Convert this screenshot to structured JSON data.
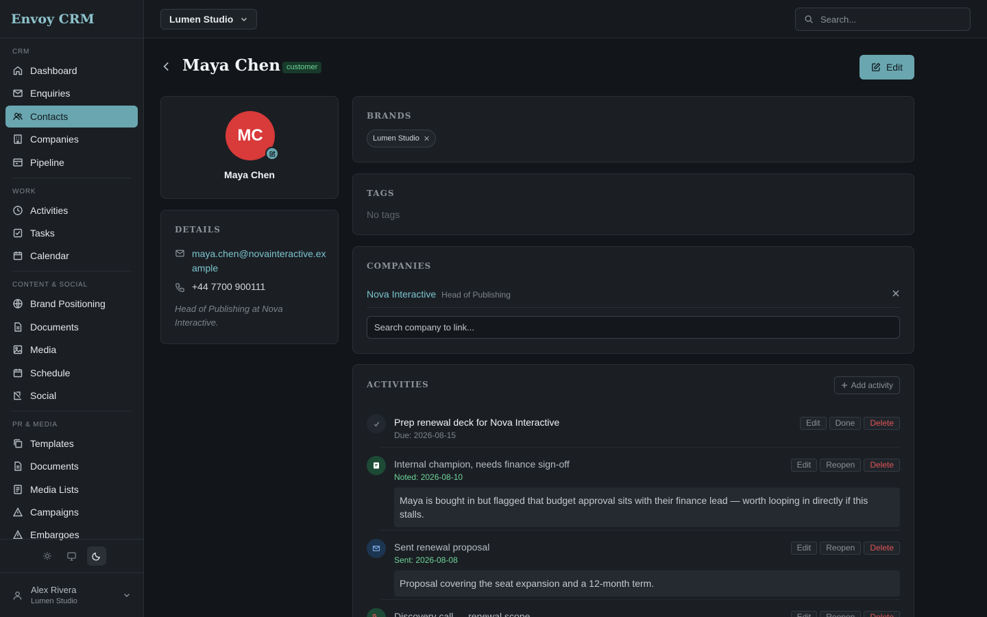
{
  "app": {
    "name": "Envoy CRM"
  },
  "sidebar": {
    "sections": [
      {
        "label": "CRM",
        "items": [
          "Dashboard",
          "Enquiries",
          "Contacts",
          "Companies",
          "Pipeline"
        ]
      },
      {
        "label": "WORK",
        "items": [
          "Activities",
          "Tasks",
          "Calendar"
        ]
      },
      {
        "label": "CONTENT & SOCIAL",
        "items": [
          "Brand Positioning",
          "Documents",
          "Media",
          "Schedule",
          "Social"
        ]
      },
      {
        "label": "PR & MEDIA",
        "items": [
          "Templates",
          "Documents",
          "Media Lists",
          "Campaigns",
          "Embargoes"
        ]
      }
    ],
    "active_item": "Contacts",
    "theme_modes": [
      "light",
      "system",
      "dark"
    ],
    "active_theme": "dark",
    "user": {
      "name": "Alex Rivera",
      "org": "Lumen Studio"
    }
  },
  "topbar": {
    "brand_selector": "Lumen Studio",
    "search_placeholder": "Search..."
  },
  "contact": {
    "name": "Maya Chen",
    "status_badge": "customer",
    "initials": "MC",
    "edit_label": "Edit",
    "details": {
      "title": "DETAILS",
      "email": "maya.chen@novainteractive.example",
      "phone": "+44 7700 900111",
      "note": "Head of Publishing at Nova Interactive."
    }
  },
  "brands": {
    "title": "BRANDS",
    "items": [
      "Lumen Studio"
    ]
  },
  "tags": {
    "title": "TAGS",
    "empty_text": "No tags"
  },
  "companies": {
    "title": "COMPANIES",
    "links": [
      {
        "name": "Nova Interactive",
        "role": "Head of Publishing"
      }
    ],
    "search_placeholder": "Search company to link..."
  },
  "activities": {
    "title": "ACTIVITIES",
    "add_label": "Add activity",
    "items": [
      {
        "type": "task",
        "title": "Prep renewal deck for Nova Interactive",
        "meta": "Due: 2026-08-15",
        "actions": [
          "Edit",
          "Done",
          "Delete"
        ]
      },
      {
        "type": "note",
        "title": "Internal champion, needs finance sign-off",
        "meta": "Noted: 2026-08-10",
        "body": "Maya is bought in but flagged that budget approval sits with their finance lead — worth looping in directly if this stalls.",
        "actions": [
          "Edit",
          "Reopen",
          "Delete"
        ]
      },
      {
        "type": "email",
        "title": "Sent renewal proposal",
        "meta": "Sent: 2026-08-08",
        "body": "Proposal covering the seat expansion and a 12-month term.",
        "actions": [
          "Edit",
          "Reopen",
          "Delete"
        ]
      },
      {
        "type": "call",
        "title": "Discovery call — renewal scope",
        "actions": [
          "Edit",
          "Reopen",
          "Delete"
        ]
      }
    ]
  },
  "colors": {
    "accent": "#6aa6b0",
    "background": "#121519",
    "card": "#1b1f24",
    "link": "#7cc4cf",
    "success": "#6fd49a",
    "danger": "#e05555",
    "avatar": "#d93a3a"
  }
}
